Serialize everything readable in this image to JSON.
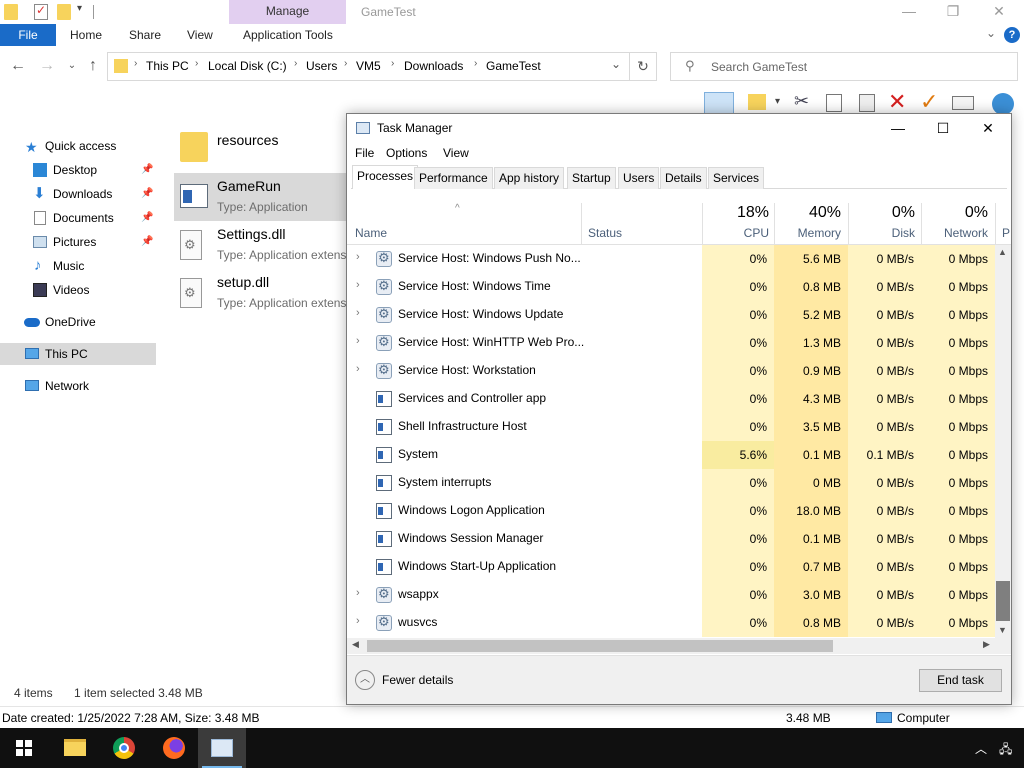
{
  "explorer": {
    "title": "GameTest",
    "contextual_tab": "Manage",
    "ribbon_tabs": [
      "File",
      "Home",
      "Share",
      "View",
      "Application Tools"
    ],
    "breadcrumb": [
      "This PC",
      "Local Disk (C:)",
      "Users",
      "VM5",
      "Downloads",
      "GameTest"
    ],
    "search_placeholder": "Search GameTest",
    "nav": [
      {
        "label": "Quick access",
        "icon": "star-icon"
      },
      {
        "label": "Desktop",
        "icon": "desktop-icon",
        "pinned": true
      },
      {
        "label": "Downloads",
        "icon": "download-icon",
        "pinned": true
      },
      {
        "label": "Documents",
        "icon": "documents-icon",
        "pinned": true
      },
      {
        "label": "Pictures",
        "icon": "pictures-icon",
        "pinned": true
      },
      {
        "label": "Music",
        "icon": "music-icon"
      },
      {
        "label": "Videos",
        "icon": "videos-icon"
      },
      {
        "label": "OneDrive",
        "icon": "cloud-icon"
      },
      {
        "label": "This PC",
        "icon": "computer-icon",
        "selected": true
      },
      {
        "label": "Network",
        "icon": "network-icon"
      }
    ],
    "files": [
      {
        "name": "resources",
        "type": ""
      },
      {
        "name": "GameRun",
        "type": "Type: Application"
      },
      {
        "name": "Settings.dll",
        "type": "Type: Application extens"
      },
      {
        "name": "setup.dll",
        "type": "Type: Application extens"
      }
    ],
    "status": {
      "count": "4 items",
      "selected": "1 item selected  3.48 MB"
    },
    "details": {
      "text": "Date created: 1/25/2022 7:28 AM, Size: 3.48 MB",
      "size": "3.48 MB",
      "location": "Computer"
    }
  },
  "taskmgr": {
    "title": "Task Manager",
    "menu": [
      "File",
      "Options",
      "View"
    ],
    "tabs": [
      "Processes",
      "Performance",
      "App history",
      "Startup",
      "Users",
      "Details",
      "Services"
    ],
    "columns": {
      "name": "Name",
      "status": "Status",
      "cpu_pct": "18%",
      "cpu": "CPU",
      "mem_pct": "40%",
      "mem": "Memory",
      "disk_pct": "0%",
      "disk": "Disk",
      "net_pct": "0%",
      "net": "Network",
      "extra": "P"
    },
    "rows": [
      {
        "name": "Service Host: Windows Push No...",
        "icon": "gear",
        "expandable": true,
        "cpu": "0%",
        "mem": "5.6 MB",
        "disk": "0 MB/s",
        "net": "0 Mbps"
      },
      {
        "name": "Service Host: Windows Time",
        "icon": "gear",
        "expandable": true,
        "cpu": "0%",
        "mem": "0.8 MB",
        "disk": "0 MB/s",
        "net": "0 Mbps"
      },
      {
        "name": "Service Host: Windows Update",
        "icon": "gear",
        "expandable": true,
        "cpu": "0%",
        "mem": "5.2 MB",
        "disk": "0 MB/s",
        "net": "0 Mbps"
      },
      {
        "name": "Service Host: WinHTTP Web Pro...",
        "icon": "gear",
        "expandable": true,
        "cpu": "0%",
        "mem": "1.3 MB",
        "disk": "0 MB/s",
        "net": "0 Mbps"
      },
      {
        "name": "Service Host: Workstation",
        "icon": "gear",
        "expandable": true,
        "cpu": "0%",
        "mem": "0.9 MB",
        "disk": "0 MB/s",
        "net": "0 Mbps"
      },
      {
        "name": "Services and Controller app",
        "icon": "app",
        "expandable": false,
        "cpu": "0%",
        "mem": "4.3 MB",
        "disk": "0 MB/s",
        "net": "0 Mbps"
      },
      {
        "name": "Shell Infrastructure Host",
        "icon": "app",
        "expandable": false,
        "cpu": "0%",
        "mem": "3.5 MB",
        "disk": "0 MB/s",
        "net": "0 Mbps"
      },
      {
        "name": "System",
        "icon": "app",
        "expandable": false,
        "cpu": "5.6%",
        "mem": "0.1 MB",
        "disk": "0.1 MB/s",
        "net": "0 Mbps"
      },
      {
        "name": "System interrupts",
        "icon": "app",
        "expandable": false,
        "cpu": "0%",
        "mem": "0 MB",
        "disk": "0 MB/s",
        "net": "0 Mbps"
      },
      {
        "name": "Windows Logon Application",
        "icon": "app",
        "expandable": false,
        "cpu": "0%",
        "mem": "18.0 MB",
        "disk": "0 MB/s",
        "net": "0 Mbps"
      },
      {
        "name": "Windows Session Manager",
        "icon": "app",
        "expandable": false,
        "cpu": "0%",
        "mem": "0.1 MB",
        "disk": "0 MB/s",
        "net": "0 Mbps"
      },
      {
        "name": "Windows Start-Up Application",
        "icon": "app",
        "expandable": false,
        "cpu": "0%",
        "mem": "0.7 MB",
        "disk": "0 MB/s",
        "net": "0 Mbps"
      },
      {
        "name": "wsappx",
        "icon": "gear",
        "expandable": true,
        "cpu": "0%",
        "mem": "3.0 MB",
        "disk": "0 MB/s",
        "net": "0 Mbps"
      },
      {
        "name": "wusvcs",
        "icon": "gear",
        "expandable": true,
        "cpu": "0%",
        "mem": "0.8 MB",
        "disk": "0 MB/s",
        "net": "0 Mbps"
      }
    ],
    "fewer_details": "Fewer details",
    "end_task": "End task"
  },
  "colors": {
    "accent": "#1a6bc8",
    "heat_low": "#fff4c4",
    "heat_med": "#ffe9a3",
    "heat_cpu_active": "#f9eca0",
    "contextual_tab_bg": "#e2cff0"
  }
}
